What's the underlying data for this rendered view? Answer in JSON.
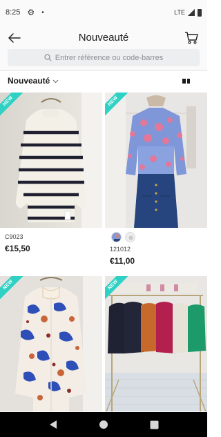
{
  "status_bar": {
    "time": "8:25",
    "gear_icon": "gear-icon",
    "dot": "•",
    "network": "LTE"
  },
  "header": {
    "title": "Nouveauté",
    "back_icon": "arrow-left-icon",
    "cart_icon": "cart-icon"
  },
  "search": {
    "placeholder": "Entrer référence ou code-barres",
    "icon": "search-icon"
  },
  "filter": {
    "sort_label": "Nouveauté",
    "sort_icon": "chevron-down-icon",
    "view_icon": "grid-view-icon"
  },
  "products": [
    {
      "badge": "NEW",
      "reference": "C9023",
      "price": "€15,50"
    },
    {
      "badge": "NEW",
      "reference": "121012",
      "price": "€11,00"
    },
    {
      "badge": "NEW",
      "reference": "",
      "price": ""
    },
    {
      "badge": "NEW",
      "reference": "",
      "price": ""
    }
  ],
  "nav": {
    "back": "nav-back-icon",
    "home": "nav-home-icon",
    "recents": "nav-recents-icon"
  },
  "colors": {
    "badge": "#2fd1c4",
    "search_bg": "#eceeef",
    "nav_bg": "#000000"
  }
}
